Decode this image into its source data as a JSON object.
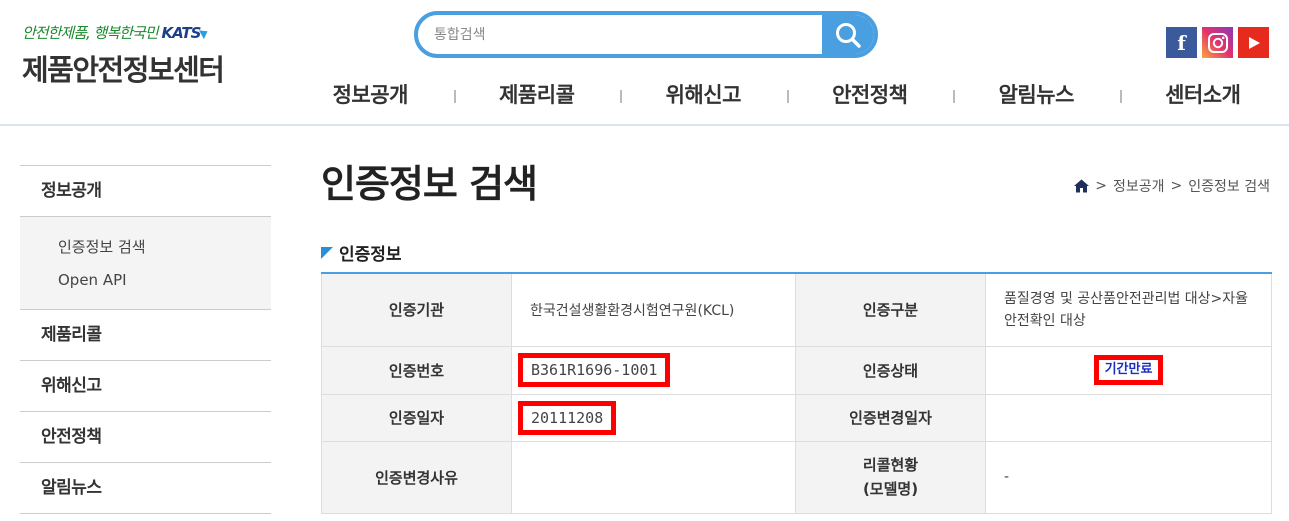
{
  "header": {
    "slogan": "안전한제품, 행복한국민",
    "agency": "KATS",
    "site_name": "제품안전정보센터",
    "search": {
      "placeholder": "통합검색",
      "value": ""
    },
    "sns": [
      "facebook-icon",
      "instagram-icon",
      "youtube-icon"
    ]
  },
  "gnb": {
    "items": [
      "정보공개",
      "제품리콜",
      "위해신고",
      "안전정책",
      "알림뉴스",
      "센터소개"
    ]
  },
  "lnb": {
    "items": [
      "정보공개",
      "제품리콜",
      "위해신고",
      "안전정책",
      "알림뉴스"
    ],
    "sub_items": [
      "인증정보 검색",
      "Open API"
    ]
  },
  "page": {
    "title": "인증정보 검색",
    "breadcrumb": [
      "정보공개",
      "인증정보 검색"
    ],
    "section_title": "인증정보"
  },
  "cert": {
    "org_label": "인증기관",
    "org_value": "한국건설생활환경시험연구원(KCL)",
    "type_label": "인증구분",
    "type_value": "품질경영 및 공산품안전관리법 대상>자율안전확인 대상",
    "no_label": "인증번호",
    "no_value": "B361R1696-1001",
    "status_label": "인증상태",
    "status_value": "기간만료",
    "date_label": "인증일자",
    "date_value": "20111208",
    "change_date_label": "인증변경일자",
    "change_date_value": "",
    "change_reason_label": "인증변경사유",
    "change_reason_value": "",
    "recall_label_1": "리콜현황",
    "recall_label_2": "(모델명)",
    "recall_value": "-"
  },
  "colors": {
    "accent": "#4a9fe0",
    "highlight": "#ff0000",
    "status_text": "#1c2ec0"
  }
}
